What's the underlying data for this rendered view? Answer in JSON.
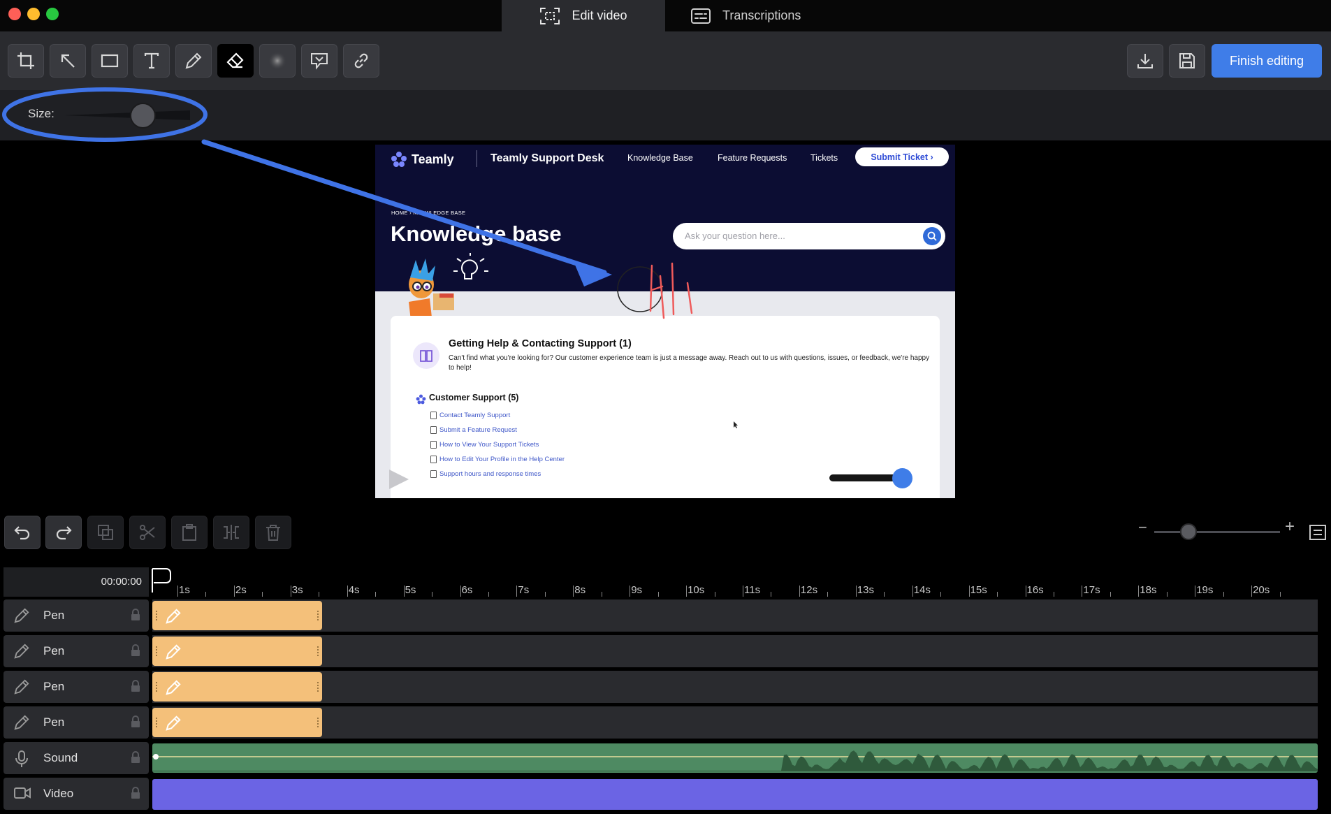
{
  "window": {
    "tabs": [
      {
        "label": "Edit video",
        "icon": "screen-capture-icon",
        "active": true
      },
      {
        "label": "Transcriptions",
        "icon": "transcript-icon",
        "active": false
      }
    ]
  },
  "toolbar": {
    "tools": [
      "crop-icon",
      "arrow-icon",
      "rectangle-icon",
      "text-icon",
      "pen-icon",
      "eraser-icon",
      "blur-icon",
      "highlight-icon",
      "link-icon"
    ],
    "active_tool": "eraser-icon",
    "finish_label": "Finish editing"
  },
  "options": {
    "size_label": "Size:",
    "size_value": 0.55
  },
  "preview": {
    "brand": "Teamly",
    "desk_title": "Teamly Support Desk",
    "nav": [
      "Knowledge Base",
      "Feature Requests",
      "Tickets"
    ],
    "submit": "Submit Ticket ›",
    "breadcrumb": "HOME  ›  KNOWLEDGE BASE",
    "page_title": "Knowledge base",
    "search_placeholder": "Ask your question here...",
    "card_title": "Getting Help & Contacting Support (1)",
    "card_desc": "Can't find what you're looking for? Our customer experience team is just a message away. Reach out to us with questions, issues, or feedback, we're happy to help!",
    "section_title": "Customer Support (5)",
    "links": [
      "Contact Teamly Support",
      "Submit a Feature Request",
      "How to View Your Support Tickets",
      "How to Edit Your Profile in the Help Center",
      "Support hours and response times"
    ]
  },
  "edit_controls": {
    "buttons": [
      "undo-icon",
      "redo-icon",
      "duplicate-icon",
      "cut-icon",
      "paste-icon",
      "split-icon",
      "delete-icon"
    ],
    "zoom_minus": "−",
    "zoom_plus": "+"
  },
  "timeline": {
    "current_time": "00:00:00",
    "ruler": [
      "1s",
      "2s",
      "3s",
      "4s",
      "5s",
      "6s",
      "7s",
      "8s",
      "9s",
      "10s",
      "11s",
      "12s",
      "13s",
      "14s",
      "15s",
      "16s",
      "17s",
      "18s",
      "19s",
      "20s"
    ],
    "tracks": [
      {
        "name": "Pen",
        "icon": "pen-icon",
        "clip_color": "#f4c07a"
      },
      {
        "name": "Pen",
        "icon": "pen-icon",
        "clip_color": "#f4c07a"
      },
      {
        "name": "Pen",
        "icon": "pen-icon",
        "clip_color": "#f4c07a"
      },
      {
        "name": "Pen",
        "icon": "pen-icon",
        "clip_color": "#f4c07a"
      },
      {
        "name": "Sound",
        "icon": "microphone-icon",
        "clip_color": "#4e8a62"
      },
      {
        "name": "Video",
        "icon": "video-camera-icon",
        "clip_color": "#6b64e4"
      }
    ]
  },
  "colors": {
    "accent": "#3f7de8",
    "annotation": "#3f73e6",
    "pen_stroke": "#ef5a5a"
  }
}
